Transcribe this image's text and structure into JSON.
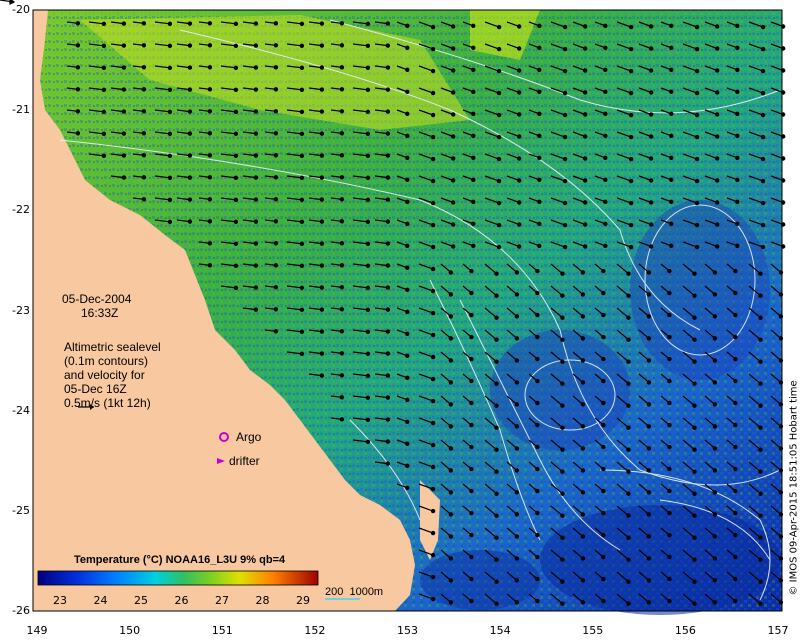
{
  "map": {
    "date": "05-Dec-2004",
    "time": "16:33Z",
    "legend_text": [
      "Altimetric sealevel",
      "(0.1m contours)",
      "and velocity for",
      "05-Dec 16Z",
      "0.5m/s (1kt 12h)"
    ],
    "argo_label": "Argo",
    "drifter_label": "drifter",
    "colorbar_title": "Temperature (°C) NOAA16_L3U 9% qb=4",
    "colorbar_ticks": [
      "23",
      "24",
      "25",
      "26",
      "27",
      "28",
      "29"
    ],
    "depth_label": "200  1000m",
    "credit": "© IMOS 09-Apr-2015 18:51:05 Hobart time",
    "lon_ticks": [
      "149",
      "150",
      "151",
      "152",
      "153",
      "154",
      "155",
      "156",
      "157"
    ],
    "lat_ticks": [
      "-20",
      "-21",
      "-22",
      "-23",
      "-24",
      "-25",
      "-26"
    ],
    "lon_range": [
      149,
      157
    ],
    "lat_range": [
      -26,
      -20
    ],
    "colors": {
      "land": "#F8C9A0",
      "ocean_warm": "#33AA33",
      "ocean_cool": "#1144CC",
      "contour": "#E8F0FF",
      "argo": "#CC00CC",
      "drifter": "#CC00CC"
    }
  }
}
